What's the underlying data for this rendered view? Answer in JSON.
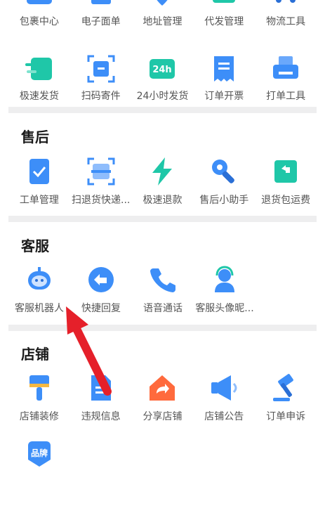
{
  "logistics": {
    "items": [
      {
        "label": "包裹中心",
        "icon": "package-icon"
      },
      {
        "label": "电子面单",
        "icon": "e-waybill-icon"
      },
      {
        "label": "地址管理",
        "icon": "location-pin-icon"
      },
      {
        "label": "代发管理",
        "icon": "dropship-icon"
      },
      {
        "label": "物流工具",
        "icon": "truck-icon"
      },
      {
        "label": "极速发货",
        "icon": "fast-ship-icon"
      },
      {
        "label": "扫码寄件",
        "icon": "scan-box-icon"
      },
      {
        "label": "24小时发货",
        "icon": "truck-24h-icon",
        "badge": "24h"
      },
      {
        "label": "订单开票",
        "icon": "invoice-icon"
      },
      {
        "label": "打单工具",
        "icon": "printer-icon"
      }
    ]
  },
  "after_sales": {
    "title": "售后",
    "items": [
      {
        "label": "工单管理",
        "icon": "work-order-icon"
      },
      {
        "label": "扫退货快递...",
        "icon": "scan-return-icon"
      },
      {
        "label": "极速退款",
        "icon": "lightning-icon"
      },
      {
        "label": "售后小助手",
        "icon": "wrench-icon"
      },
      {
        "label": "退货包运费",
        "icon": "return-box-icon"
      }
    ]
  },
  "customer_service": {
    "title": "客服",
    "items": [
      {
        "label": "客服机器人",
        "icon": "robot-icon"
      },
      {
        "label": "快捷回复",
        "icon": "reply-icon"
      },
      {
        "label": "语音通话",
        "icon": "phone-icon"
      },
      {
        "label": "客服头像昵...",
        "icon": "headset-avatar-icon"
      }
    ]
  },
  "store": {
    "title": "店铺",
    "items": [
      {
        "label": "店铺装修",
        "icon": "paint-brush-icon"
      },
      {
        "label": "违规信息",
        "icon": "violation-doc-icon"
      },
      {
        "label": "分享店铺",
        "icon": "share-store-icon"
      },
      {
        "label": "店铺公告",
        "icon": "megaphone-icon"
      },
      {
        "label": "订单申诉",
        "icon": "gavel-icon"
      },
      {
        "label": "",
        "icon": "brand-icon",
        "badge": "品牌"
      }
    ]
  },
  "colors": {
    "primary_blue": "#3d8ef8",
    "teal": "#1fc7a8",
    "orange": "#ff6a3d",
    "arrow_red": "#e5202a"
  }
}
